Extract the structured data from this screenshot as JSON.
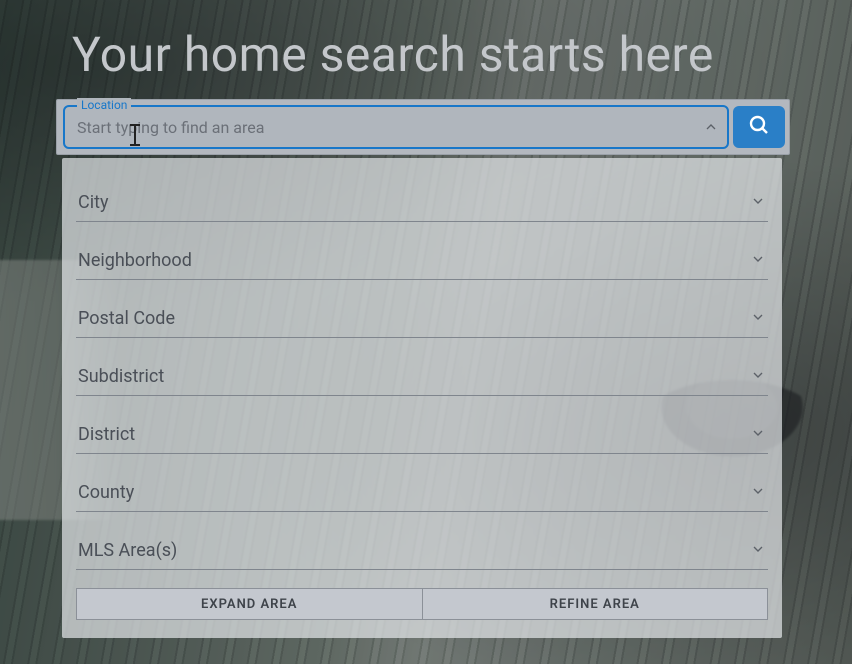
{
  "heading": "Your home search starts here",
  "search": {
    "label": "Location",
    "placeholder": "Start typing to find an area",
    "value": ""
  },
  "options": [
    {
      "label": "City"
    },
    {
      "label": "Neighborhood"
    },
    {
      "label": "Postal Code"
    },
    {
      "label": "Subdistrict"
    },
    {
      "label": "District"
    },
    {
      "label": "County"
    },
    {
      "label": "MLS Area(s)"
    }
  ],
  "buttons": {
    "expand": "EXPAND AREA",
    "refine": "REFINE AREA"
  },
  "colors": {
    "accent": "#1877c9",
    "button": "#2a7fc7"
  }
}
